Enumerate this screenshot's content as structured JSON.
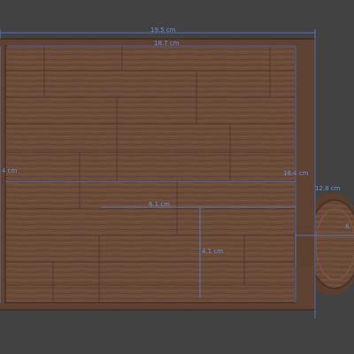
{
  "viewport": {
    "background": "#424242"
  },
  "board": {
    "wood_dark": "#5e4232",
    "wood_mid": "#6f4f3c",
    "wood_light": "#7a5843",
    "rim": "#6a4a38"
  },
  "dimensions": {
    "color": "#5f82d8",
    "overall_width": "19.5 cm",
    "inner_width": "18.7 cm",
    "left_height": "4 cm",
    "right_height": "16.4 cm",
    "handle_height": "12.8 cm",
    "inset_width": "6.1 cm",
    "inset_height": "4.1 cm",
    "handle_label": "8."
  }
}
